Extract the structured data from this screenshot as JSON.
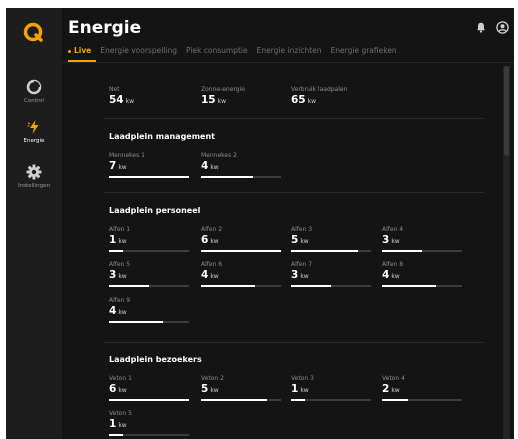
{
  "app": {
    "title": "Energie",
    "accent": "#f5a300"
  },
  "sidebar": {
    "items": [
      {
        "label": "Control",
        "icon": "pie-chart-icon",
        "active": false
      },
      {
        "label": "Energie",
        "icon": "lightning-icon",
        "active": true
      },
      {
        "label": "Instellingen",
        "icon": "gear-icon",
        "active": false
      }
    ]
  },
  "header": {
    "icons": [
      "bell-icon",
      "user-icon"
    ]
  },
  "tabs": [
    {
      "label": "Live",
      "active": true
    },
    {
      "label": "Energie voorspelling",
      "active": false
    },
    {
      "label": "Piek consumptie",
      "active": false
    },
    {
      "label": "Energie inzichten",
      "active": false
    },
    {
      "label": "Energie grafieken",
      "active": false
    }
  ],
  "summary": [
    {
      "label": "Net",
      "value": "54",
      "unit": "kw"
    },
    {
      "label": "Zonne-energie",
      "value": "15",
      "unit": "kw"
    },
    {
      "label": "Verbruik laadpalen",
      "value": "65",
      "unit": "kw"
    }
  ],
  "sections": [
    {
      "title": "Laadplein management",
      "items": [
        {
          "label": "Mennekes 1",
          "value": "7",
          "unit": "kw",
          "level": 1.0
        },
        {
          "label": "Mennekes 2",
          "value": "4",
          "unit": "kw",
          "level": 0.65
        }
      ]
    },
    {
      "title": "Laadplein personeel",
      "items": [
        {
          "label": "Alfen 1",
          "value": "1",
          "unit": "kw",
          "level": 0.17
        },
        {
          "label": "Alfen 2",
          "value": "6",
          "unit": "kw",
          "level": 1.0
        },
        {
          "label": "Alfen 3",
          "value": "5",
          "unit": "kw",
          "level": 0.84
        },
        {
          "label": "Alfen 4",
          "value": "3",
          "unit": "kw",
          "level": 0.5
        },
        {
          "label": "Alfen 5",
          "value": "3",
          "unit": "kw",
          "level": 0.5
        },
        {
          "label": "Alfen 6",
          "value": "4",
          "unit": "kw",
          "level": 0.67
        },
        {
          "label": "Alfen 7",
          "value": "3",
          "unit": "kw",
          "level": 0.5
        },
        {
          "label": "Alfen 8",
          "value": "4",
          "unit": "kw",
          "level": 0.67
        },
        {
          "label": "Alfen 9",
          "value": "4",
          "unit": "kw",
          "level": 0.67
        }
      ]
    },
    {
      "title": "Laadplein bezoekers",
      "items": [
        {
          "label": "Veton 1",
          "value": "6",
          "unit": "kw",
          "level": 1.0
        },
        {
          "label": "Veton 2",
          "value": "5",
          "unit": "kw",
          "level": 0.83
        },
        {
          "label": "Veton 3",
          "value": "1",
          "unit": "kw",
          "level": 0.17
        },
        {
          "label": "Veton 4",
          "value": "2",
          "unit": "kw",
          "level": 0.33
        },
        {
          "label": "Veton 5",
          "value": "1",
          "unit": "kw",
          "level": 0.17
        }
      ]
    }
  ]
}
